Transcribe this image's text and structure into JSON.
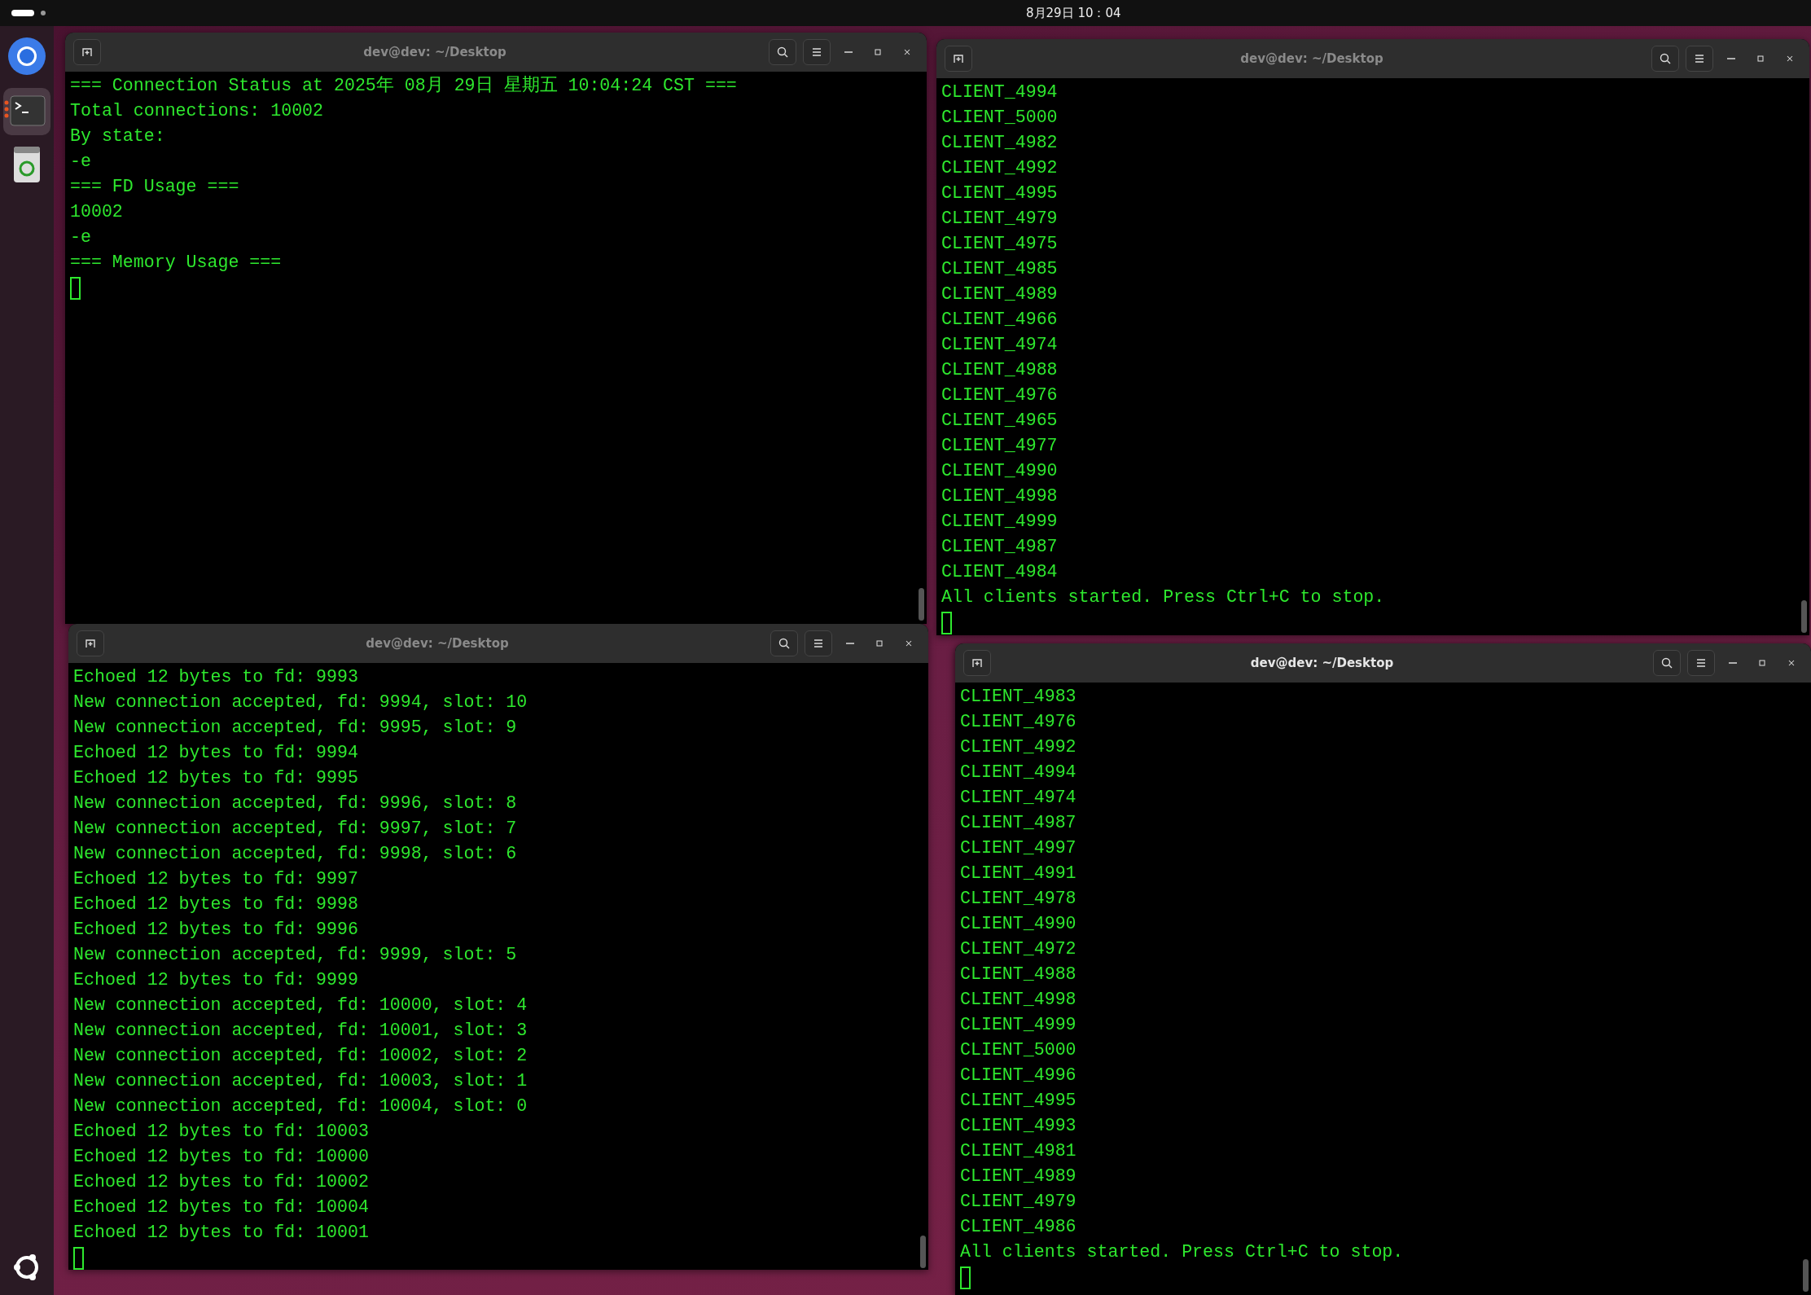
{
  "top_bar": {
    "clock": "8月29日  10：04"
  },
  "windows": [
    {
      "title": "dev@dev: ~/Desktop",
      "focused": false,
      "lines": [
        "=== Connection Status at 2025年 08月 29日 星期五 10:04:24 CST ===",
        "Total connections: 10002",
        "By state:",
        "-e",
        "=== FD Usage ===",
        "10002",
        "-e",
        "=== Memory Usage ==="
      ]
    },
    {
      "title": "dev@dev: ~/Desktop",
      "focused": false,
      "lines": [
        "CLIENT_4994",
        "CLIENT_5000",
        "CLIENT_4982",
        "CLIENT_4992",
        "CLIENT_4995",
        "CLIENT_4979",
        "CLIENT_4975",
        "CLIENT_4985",
        "CLIENT_4989",
        "CLIENT_4966",
        "CLIENT_4974",
        "CLIENT_4988",
        "CLIENT_4976",
        "CLIENT_4965",
        "CLIENT_4977",
        "CLIENT_4990",
        "CLIENT_4998",
        "CLIENT_4999",
        "CLIENT_4987",
        "CLIENT_4984",
        "All clients started. Press Ctrl+C to stop."
      ]
    },
    {
      "title": "dev@dev: ~/Desktop",
      "focused": false,
      "lines": [
        "Echoed 12 bytes to fd: 9993",
        "New connection accepted, fd: 9994, slot: 10",
        "New connection accepted, fd: 9995, slot: 9",
        "Echoed 12 bytes to fd: 9994",
        "Echoed 12 bytes to fd: 9995",
        "New connection accepted, fd: 9996, slot: 8",
        "New connection accepted, fd: 9997, slot: 7",
        "New connection accepted, fd: 9998, slot: 6",
        "Echoed 12 bytes to fd: 9997",
        "Echoed 12 bytes to fd: 9998",
        "Echoed 12 bytes to fd: 9996",
        "New connection accepted, fd: 9999, slot: 5",
        "Echoed 12 bytes to fd: 9999",
        "New connection accepted, fd: 10000, slot: 4",
        "New connection accepted, fd: 10001, slot: 3",
        "New connection accepted, fd: 10002, slot: 2",
        "New connection accepted, fd: 10003, slot: 1",
        "New connection accepted, fd: 10004, slot: 0",
        "Echoed 12 bytes to fd: 10003",
        "Echoed 12 bytes to fd: 10000",
        "Echoed 12 bytes to fd: 10002",
        "Echoed 12 bytes to fd: 10004",
        "Echoed 12 bytes to fd: 10001"
      ]
    },
    {
      "title": "dev@dev: ~/Desktop",
      "focused": true,
      "lines": [
        "CLIENT_4983",
        "CLIENT_4976",
        "CLIENT_4992",
        "CLIENT_4994",
        "CLIENT_4974",
        "CLIENT_4987",
        "CLIENT_4997",
        "CLIENT_4991",
        "CLIENT_4978",
        "CLIENT_4990",
        "CLIENT_4972",
        "CLIENT_4988",
        "CLIENT_4998",
        "CLIENT_4999",
        "CLIENT_5000",
        "CLIENT_4996",
        "CLIENT_4995",
        "CLIENT_4993",
        "CLIENT_4981",
        "CLIENT_4989",
        "CLIENT_4979",
        "CLIENT_4986",
        "All clients started. Press Ctrl+C to stop."
      ]
    }
  ]
}
